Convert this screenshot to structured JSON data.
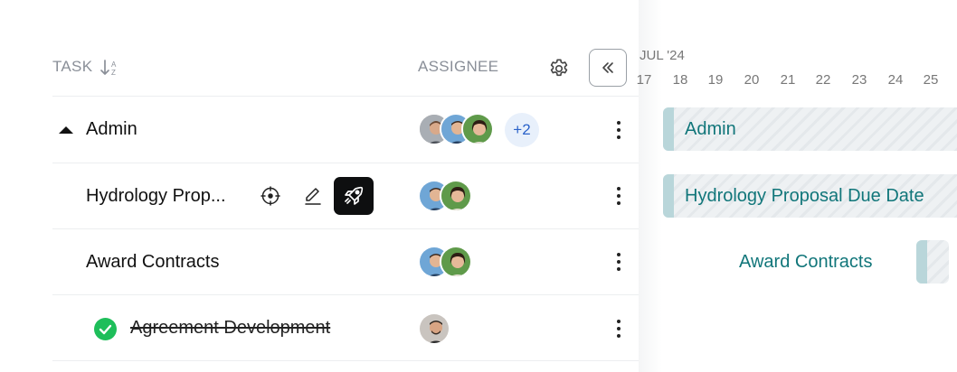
{
  "header": {
    "task_label": "TASK",
    "sort_icon": "sort-alpha-icon",
    "assignee_label": "ASSIGNEE",
    "month_label": "JUL '24"
  },
  "gantt": {
    "days": [
      "17",
      "18",
      "19",
      "20",
      "21",
      "22",
      "23",
      "24",
      "25"
    ]
  },
  "rows": [
    {
      "label": "Admin",
      "more_assignees": "+2",
      "bar_label": "Admin"
    },
    {
      "label": "Hydrology Prop...",
      "bar_label": "Hydrology Proposal Due Date"
    },
    {
      "label": "Award Contracts",
      "bar_label": "Award Contracts"
    },
    {
      "label": "Agreement Development",
      "completed": true
    }
  ],
  "colors": {
    "bar_text": "#11767a",
    "bar_handle": "#b9d6da",
    "complete_green": "#1ebe5a",
    "badge_blue": "#2a62c9"
  }
}
